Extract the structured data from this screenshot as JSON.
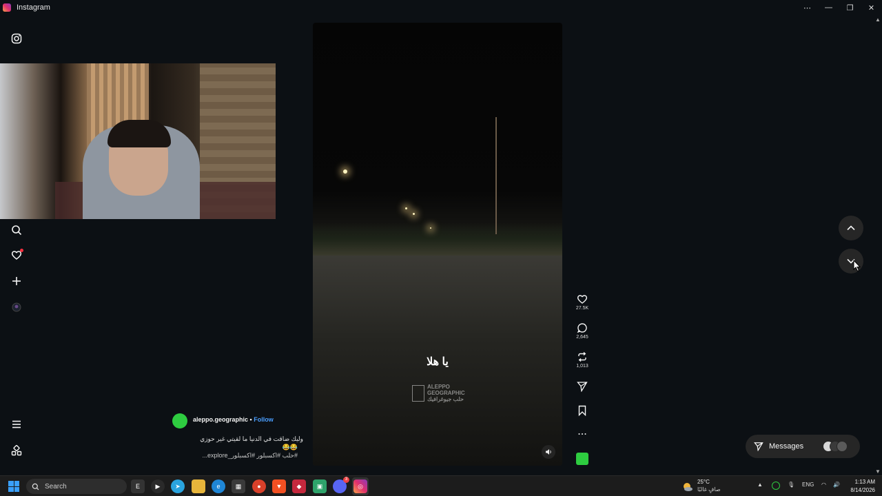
{
  "window": {
    "title": "Instagram",
    "controls": [
      "⋯",
      "—",
      "❐",
      "✕"
    ]
  },
  "sidebar": {
    "items": [
      {
        "name": "instagram-logo-icon"
      },
      {
        "name": "search-icon"
      },
      {
        "name": "notifications-heart-icon"
      },
      {
        "name": "create-plus-icon"
      },
      {
        "name": "profile-avatar"
      },
      {
        "name": "menu-icon"
      },
      {
        "name": "more-apps-icon"
      }
    ]
  },
  "reel": {
    "caption_overlay": "يا هلا",
    "watermark_line1": "ALEPPO",
    "watermark_line2": "GEOGRAPHIC",
    "watermark_line3": "حلب جيوغرافيك",
    "username": "aleppo.geographic",
    "follow_label": "Follow",
    "separator": "•",
    "caption_line1": "وليك ضاقت في الدنيا ما لقيتي غير حوزي",
    "caption_line2": "😂😂",
    "caption_line3": "#حلب #اكسبلور #اكسبلور_explore..."
  },
  "actions": {
    "likes": "27.5K",
    "comments": "2,645",
    "reposts": "1,013"
  },
  "messages": {
    "label": "Messages"
  },
  "taskbar": {
    "search_label": "Search",
    "weather_temp": "25°C",
    "weather_desc": "صافٍ غالبًا",
    "language": "ENG",
    "time": "1:13 AM",
    "date": "8/14/2026",
    "discord_badge": "3"
  },
  "colors": {
    "background": "#0c1014",
    "accent_follow": "#4a9eff",
    "notification_dot": "#ff3040",
    "profile_green": "#2ecc40"
  }
}
